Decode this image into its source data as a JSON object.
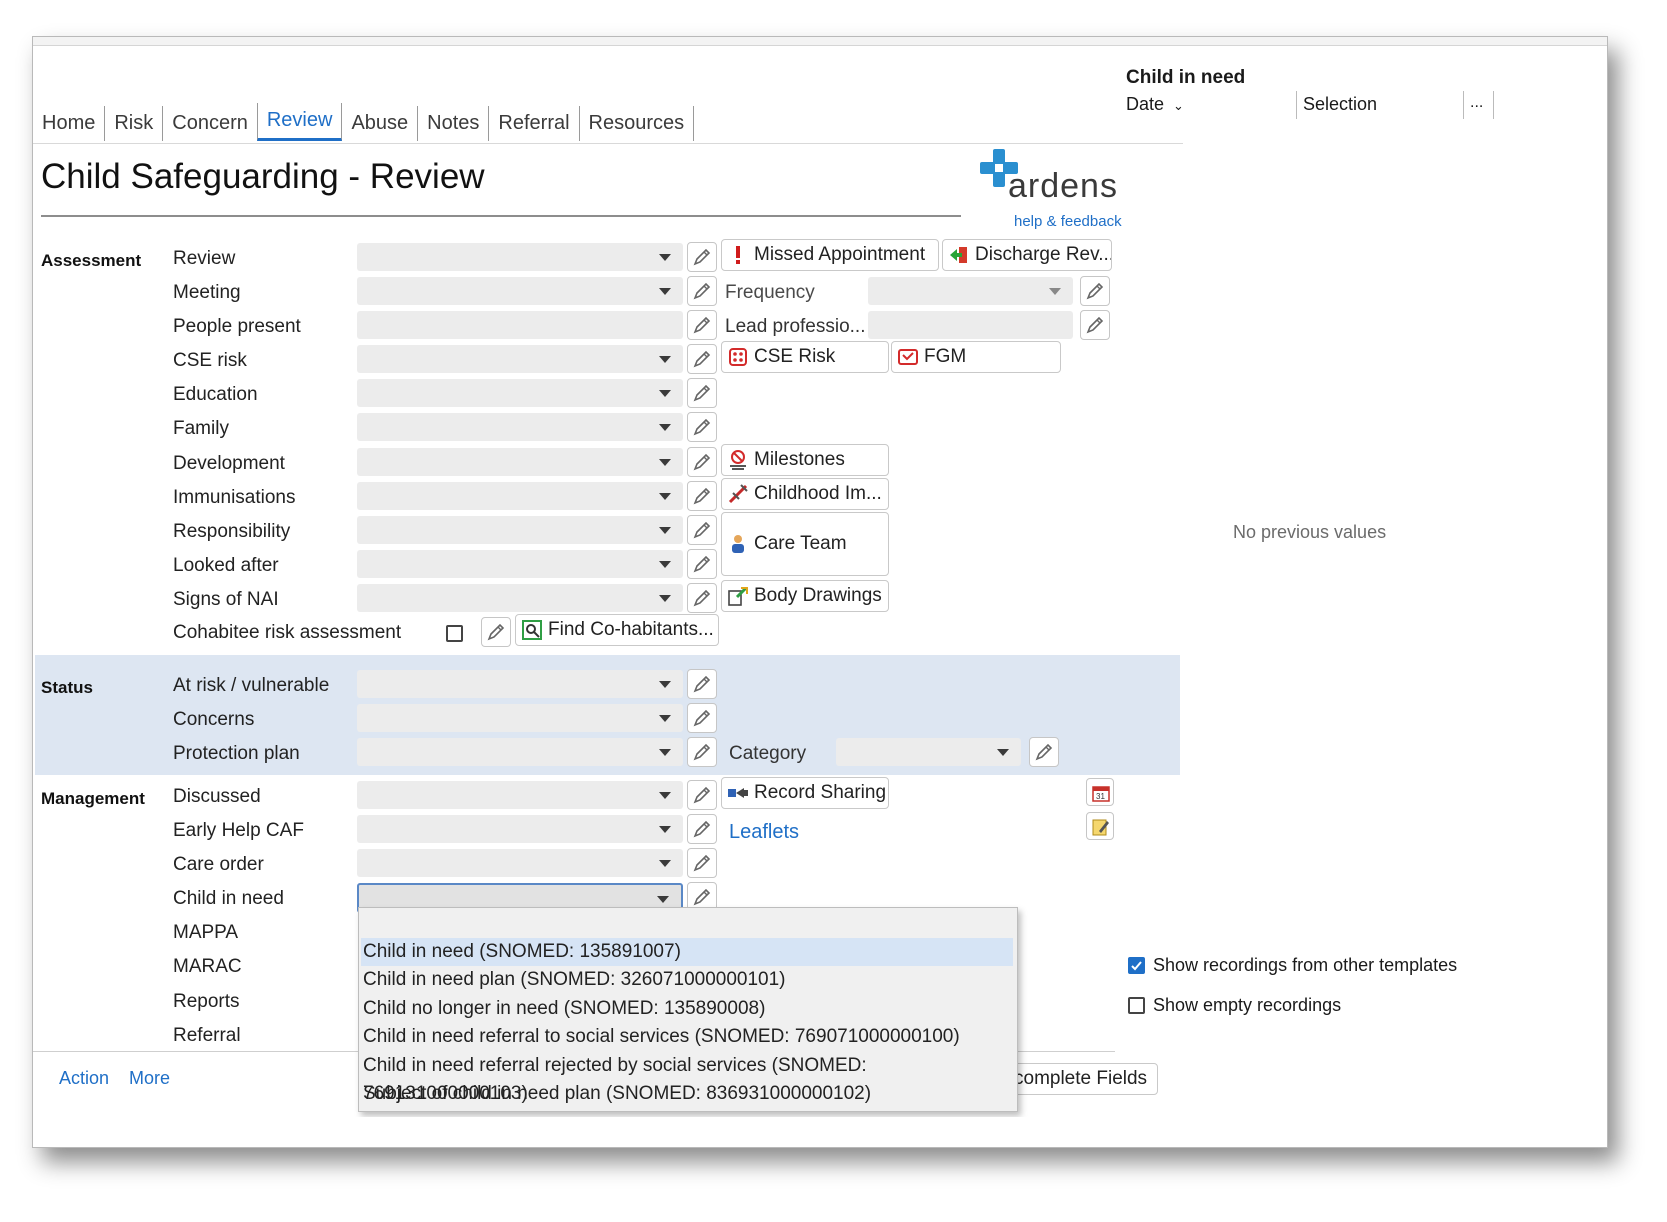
{
  "tabs": [
    "Home",
    "Risk",
    "Concern",
    "Review",
    "Abuse",
    "Notes",
    "Referral",
    "Resources"
  ],
  "active_tab": "Review",
  "title": "Child Safeguarding - Review",
  "logo": {
    "word": "ardens",
    "help": "help & feedback"
  },
  "sections": {
    "assessment": "Assessment",
    "status": "Status",
    "management": "Management"
  },
  "assessment_labels": [
    "Review",
    "Meeting",
    "People present",
    "CSE risk",
    "Education",
    "Family",
    "Development",
    "Immunisations",
    "Responsibility",
    "Looked after",
    "Signs of NAI"
  ],
  "cohabitee_label": "Cohabitee risk assessment",
  "status_labels": [
    "At risk / vulnerable",
    "Concerns",
    "Protection plan"
  ],
  "management_labels": [
    "Discussed",
    "Early Help CAF",
    "Care order",
    "Child in need",
    "MAPPA",
    "MARAC",
    "Reports",
    "Referral"
  ],
  "buttons": {
    "missed": "Missed Appointment",
    "discharge": "Discharge Rev...",
    "cse": "CSE Risk",
    "fgm": "FGM",
    "milestones": "Milestones",
    "childhood": "Childhood Im...",
    "care_team": "Care Team",
    "body": "Body Drawings",
    "find": "Find Co-habitants...",
    "record": "Record Sharing",
    "incomplete": "complete Fields"
  },
  "frequency_label": "Frequency",
  "lead_label": "Lead professio...",
  "category_label": "Category",
  "leaflets": "Leaflets",
  "bottom_links": {
    "action": "Action",
    "more": "More"
  },
  "right_panel": {
    "title": "Child in need",
    "col_date": "Date",
    "col_selection": "Selection",
    "col_more": "...",
    "empty": "No previous values",
    "show_other": "Show recordings from other templates",
    "show_other_checked": true,
    "show_empty": "Show empty recordings",
    "show_empty_checked": false
  },
  "dropdown": {
    "items": [
      "",
      "Child in need (SNOMED: 135891007)",
      "Child in need plan (SNOMED: 326071000000101)",
      "Child no longer in need (SNOMED: 135890008)",
      "Child in need referral to social services (SNOMED: 769071000000100)",
      "Child in need referral rejected by social services (SNOMED: 769131000000103)",
      "Subject of child in need plan (SNOMED: 836931000000102)"
    ],
    "highlighted": "Child in need (SNOMED: 135891007)"
  },
  "colors": {
    "accent": "#1f6fc7",
    "status_band": "#dde6f2",
    "logo_cross": "#2a8fd0"
  }
}
